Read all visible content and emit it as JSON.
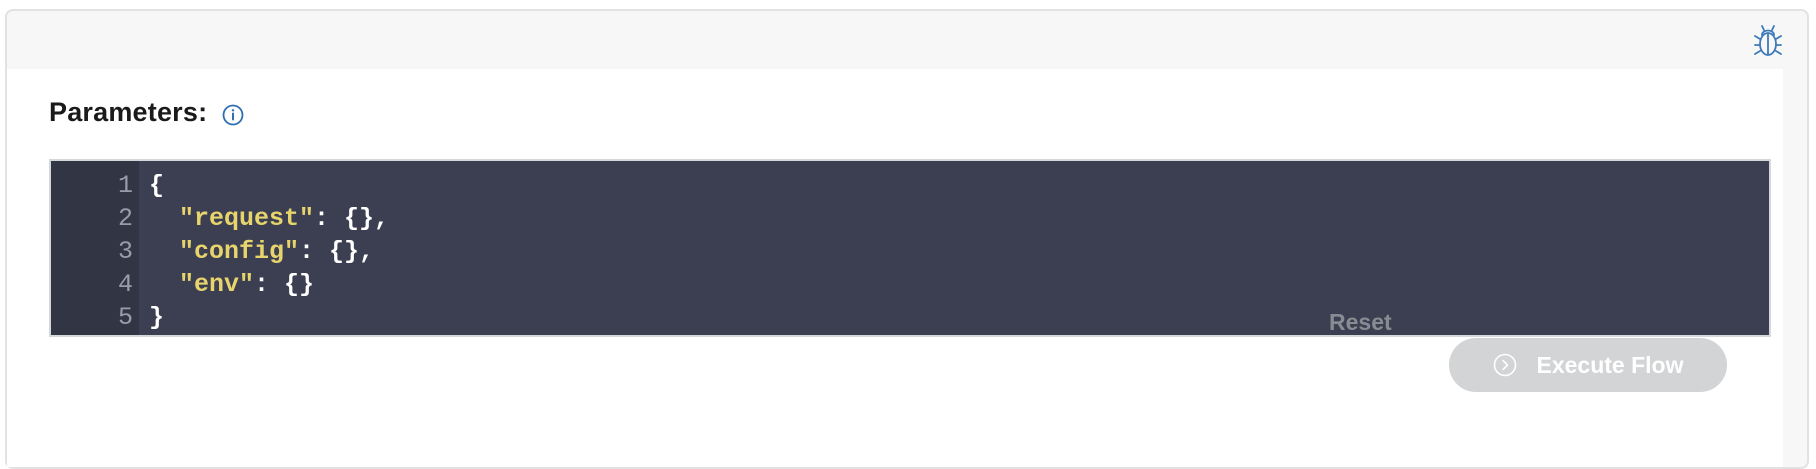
{
  "header": {
    "debug_icon": "bug-icon"
  },
  "parameters": {
    "label": "Parameters:",
    "info_icon": "info-icon"
  },
  "editor": {
    "lines": [
      {
        "number": "1",
        "tokens": [
          {
            "text": "{",
            "kind": "punc"
          }
        ]
      },
      {
        "number": "2",
        "tokens": [
          {
            "text": "  ",
            "kind": "punc"
          },
          {
            "text": "\"request\"",
            "kind": "str"
          },
          {
            "text": ": {},",
            "kind": "punc"
          }
        ]
      },
      {
        "number": "3",
        "tokens": [
          {
            "text": "  ",
            "kind": "punc"
          },
          {
            "text": "\"config\"",
            "kind": "str"
          },
          {
            "text": ": {},",
            "kind": "punc"
          }
        ]
      },
      {
        "number": "4",
        "tokens": [
          {
            "text": "  ",
            "kind": "punc"
          },
          {
            "text": "\"env\"",
            "kind": "str"
          },
          {
            "text": ": {}",
            "kind": "punc"
          }
        ]
      },
      {
        "number": "5",
        "tokens": [
          {
            "text": "}",
            "kind": "punc"
          }
        ]
      }
    ],
    "colors": {
      "background": "#3c3f51",
      "gutter": "#323544",
      "string": "#e8d46c",
      "text": "#ffffff",
      "line_number": "#9a9da8"
    }
  },
  "actions": {
    "reset_label": "Reset",
    "execute_label": "Execute Flow",
    "execute_icon": "chevron-right-circle-icon",
    "execute_disabled": true
  }
}
